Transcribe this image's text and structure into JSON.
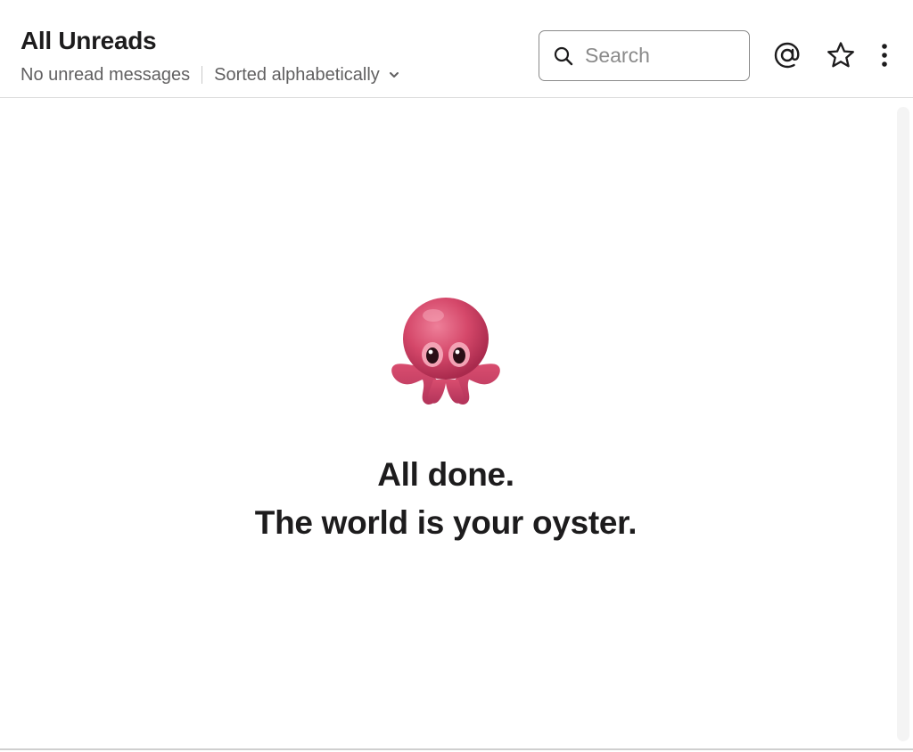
{
  "header": {
    "title": "All Unreads",
    "status": "No unread messages",
    "sort_label": "Sorted alphabetically"
  },
  "search": {
    "placeholder": "Search",
    "value": ""
  },
  "toolbar": {
    "icons": [
      "at-sign-icon",
      "star-icon",
      "more-vertical-icon"
    ]
  },
  "empty_state": {
    "icon": "octopus-emoji",
    "line1": "All done.",
    "line2": "The world is your oyster."
  },
  "colors": {
    "text": "#1d1c1d",
    "muted": "#616061",
    "octopus": "#d5486a"
  }
}
